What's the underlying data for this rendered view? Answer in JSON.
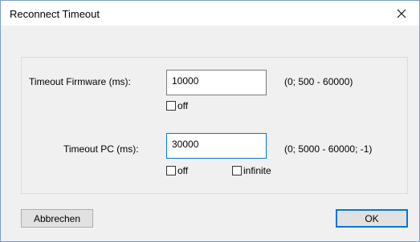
{
  "window": {
    "title": "Reconnect Timeout",
    "close_icon": "close-icon"
  },
  "firmware": {
    "label": "Timeout Firmware (ms):",
    "value": "10000",
    "range": "(0; 500 - 60000)",
    "off_label": "off",
    "off_checked": false
  },
  "pc": {
    "label": "Timeout PC (ms):",
    "value": "30000",
    "range": "(0; 5000 - 60000; -1)",
    "off_label": "off",
    "off_checked": false,
    "infinite_label": "infinite",
    "infinite_checked": false
  },
  "buttons": {
    "cancel_label": "Abbrechen",
    "ok_label": "OK"
  },
  "colors": {
    "accent": "#0078d7",
    "client_bg": "#f0f0f0"
  }
}
